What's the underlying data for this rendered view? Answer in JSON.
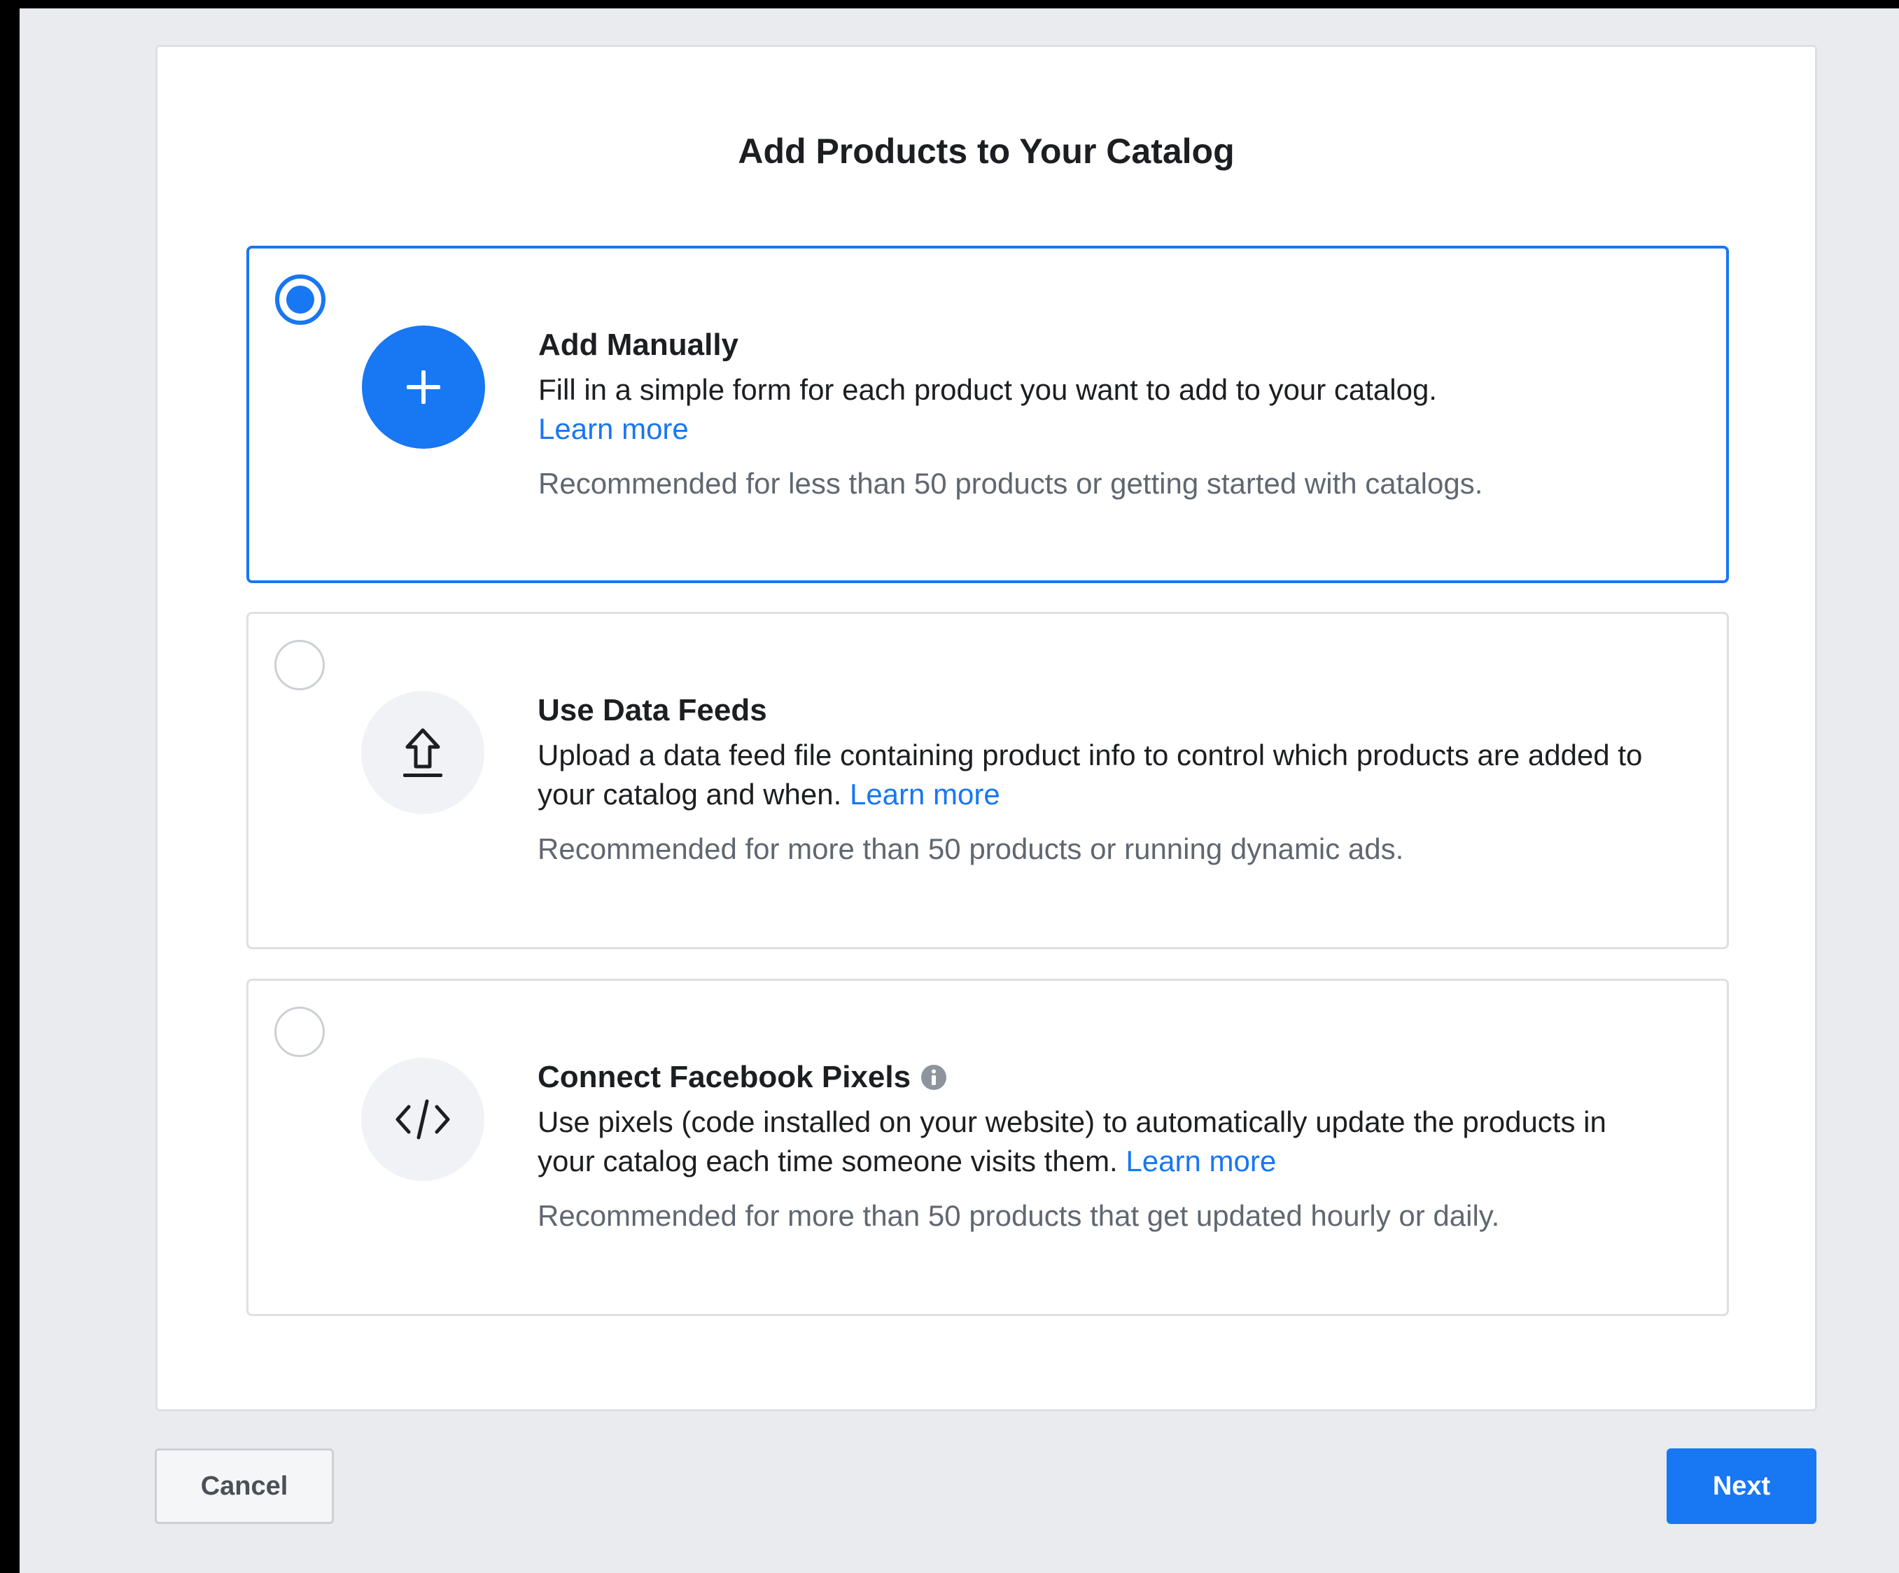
{
  "dialog": {
    "title": "Add Products to Your Catalog"
  },
  "options": [
    {
      "title": "Add Manually",
      "description": "Fill in a simple form for each product you want to add to your catalog.",
      "learn_more": "Learn more",
      "recommendation": "Recommended for less than 50 products or getting started with catalogs.",
      "selected": true,
      "icon": "plus-icon"
    },
    {
      "title": "Use Data Feeds",
      "description": "Upload a data feed file containing product info to control which products are added to your catalog and when.",
      "learn_more": "Learn more",
      "recommendation": "Recommended for more than 50 products or running dynamic ads.",
      "selected": false,
      "icon": "upload-icon"
    },
    {
      "title": "Connect Facebook Pixels",
      "description": "Use pixels (code installed on your website) to automatically update the products in your catalog each time someone visits them.",
      "learn_more": "Learn more",
      "recommendation": "Recommended for more than 50 products that get updated hourly or daily.",
      "selected": false,
      "icon": "code-icon",
      "info_icon": "info-icon"
    }
  ],
  "footer": {
    "cancel_label": "Cancel",
    "next_label": "Next"
  },
  "colors": {
    "accent": "#1877f2",
    "text_primary": "#1c1e21",
    "text_secondary": "#606770",
    "page_background": "#e9ebee"
  }
}
